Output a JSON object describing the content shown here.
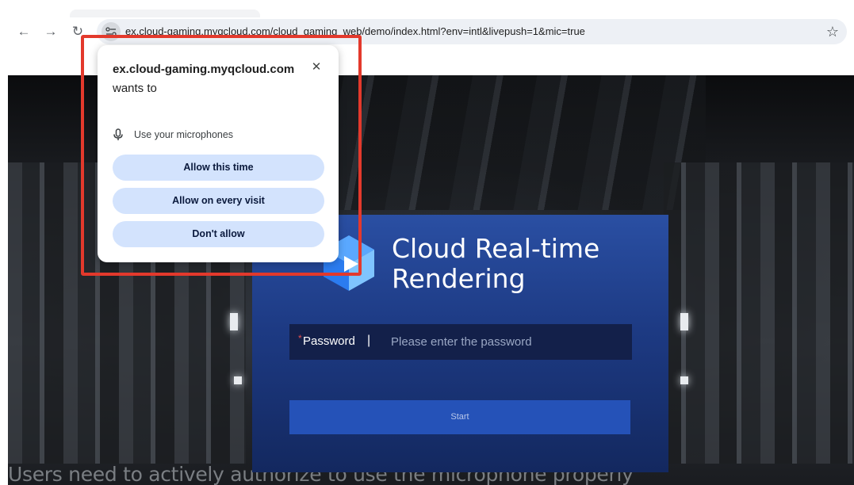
{
  "browser": {
    "back_icon": "←",
    "forward_icon": "→",
    "reload_icon": "↻",
    "url": "ex.cloud-gaming.myqcloud.com/cloud_gaming_web/demo/index.html?env=intl&livepush=1&mic=true",
    "bookmark_icon": "☆",
    "icons": [
      "back-arrow-icon",
      "forward-arrow-icon",
      "reload-icon",
      "site-info-icon",
      "star-icon"
    ]
  },
  "popup": {
    "site": "ex.cloud-gaming.myqcloud.com",
    "suffix": " wants to",
    "close_icon": "✕",
    "permission": "Use your microphones",
    "buttons": {
      "allow_once": "Allow this time",
      "allow_always": "Allow on every visit",
      "deny": "Don't allow"
    }
  },
  "app": {
    "title_line1": "Cloud Real-time",
    "title_line2": "Rendering",
    "required_mark": "*",
    "password_label": "Password",
    "separator": "|",
    "password_placeholder": "Please enter the password",
    "start_label": "Start"
  },
  "caption": "Users need to actively authorize to use the microphone properly",
  "colors": {
    "highlight": "#e3392c",
    "popup_button": "#d3e3fd",
    "panel": "#1d3a83",
    "start_button": "#2552b8"
  }
}
